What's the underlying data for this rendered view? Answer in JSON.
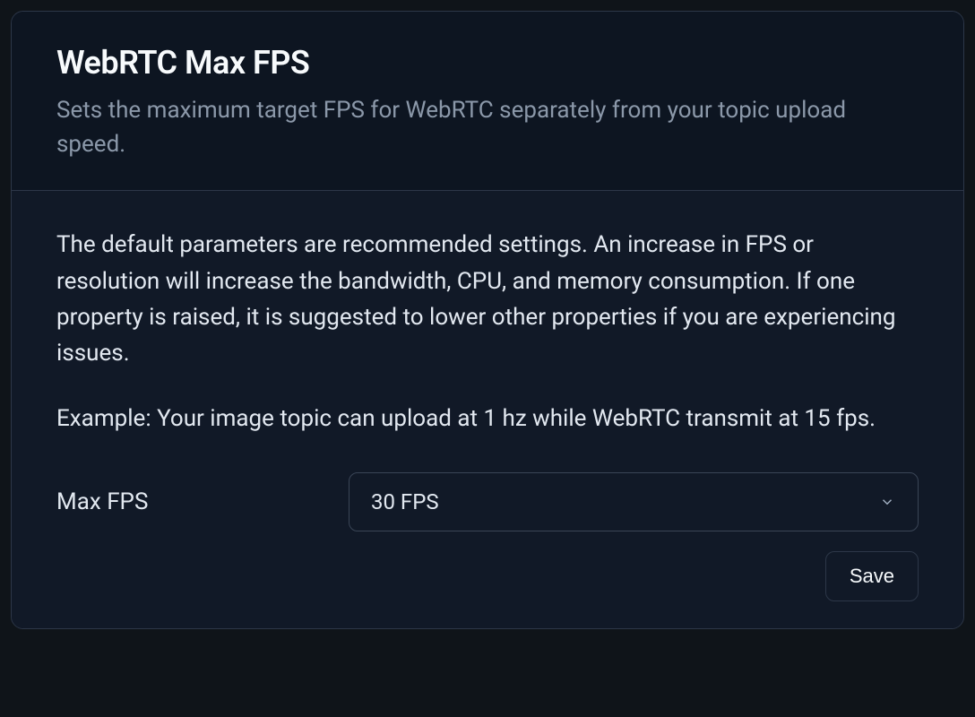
{
  "header": {
    "title": "WebRTC Max FPS",
    "subtitle": "Sets the maximum target FPS for WebRTC separately from your topic upload speed."
  },
  "body": {
    "description": "The default parameters are recommended settings. An increase in FPS or resolution will increase the bandwidth, CPU, and memory consumption. If one property is raised, it is suggested to lower other properties if you are experiencing issues.",
    "example": "Example: Your image topic can upload at 1 hz while WebRTC transmit at 15 fps."
  },
  "form": {
    "max_fps_label": "Max FPS",
    "max_fps_value": "30 FPS"
  },
  "actions": {
    "save_label": "Save"
  }
}
